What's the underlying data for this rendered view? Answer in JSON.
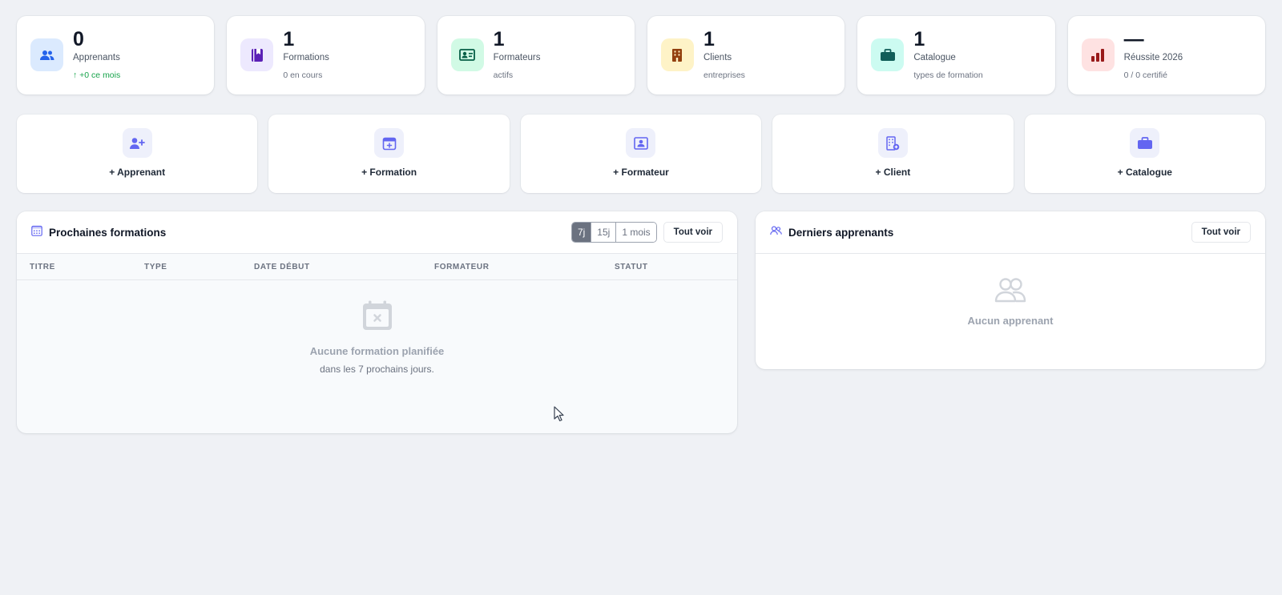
{
  "stats": [
    {
      "icon": "users-icon",
      "value": "0",
      "label": "Apprenants",
      "sub": "↑ +0 ce mois",
      "color": "#dbeafe",
      "iconColor": "#2563eb"
    },
    {
      "icon": "book-icon",
      "value": "1",
      "label": "Formations",
      "sub": "0 en cours",
      "color": "#ede9fe",
      "iconColor": "#5b21b6"
    },
    {
      "icon": "id-card-icon",
      "value": "1",
      "label": "Formateurs",
      "sub": "actifs",
      "color": "#d1fae5",
      "iconColor": "#065f46"
    },
    {
      "icon": "building-icon",
      "value": "1",
      "label": "Clients",
      "sub": "entreprises",
      "color": "#fef3c7",
      "iconColor": "#92400e"
    },
    {
      "icon": "briefcase-icon",
      "value": "1",
      "label": "Catalogue",
      "sub": "types de formation",
      "color": "#ccfbf1",
      "iconColor": "#115e59"
    },
    {
      "icon": "bar-chart-icon",
      "value": "—",
      "label": "Réussite 2026",
      "sub": "0 / 0 certifié",
      "color": "#fee2e2",
      "iconColor": "#991b1b"
    }
  ],
  "actions": [
    {
      "icon": "user-plus-icon",
      "label": "+ Apprenant"
    },
    {
      "icon": "calendar-plus-icon",
      "label": "+ Formation"
    },
    {
      "icon": "id-card-icon",
      "label": "+ Formateur"
    },
    {
      "icon": "building-plus-icon",
      "label": "+ Client"
    },
    {
      "icon": "briefcase-icon",
      "label": "+ Catalogue"
    }
  ],
  "upcoming": {
    "title": "Prochaines formations",
    "ranges": [
      "7j",
      "15j",
      "1 mois"
    ],
    "active_range": "7j",
    "see_all": "Tout voir",
    "columns": [
      "TITRE",
      "TYPE",
      "DATE DÉBUT",
      "FORMATEUR",
      "STATUT"
    ],
    "empty_title": "Aucune formation planifiée",
    "empty_sub": "dans les 7 prochains jours."
  },
  "recent": {
    "title": "Derniers apprenants",
    "see_all": "Tout voir",
    "empty_title": "Aucun apprenant"
  },
  "colors": {
    "accent": "#6366f1",
    "background": "#eff1f5",
    "success": "#16a34a"
  }
}
